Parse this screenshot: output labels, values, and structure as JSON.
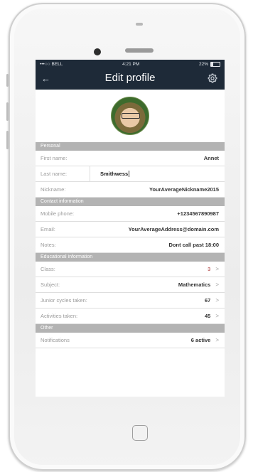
{
  "status_bar": {
    "carrier": "•••○○ BELL",
    "time": "4:21 PM",
    "battery": "22%",
    "battery_level": 0.22
  },
  "nav": {
    "title": "Edit profile",
    "back_icon": "arrow-left-icon",
    "settings_icon": "gear-icon"
  },
  "sections": {
    "personal": "Personal",
    "contact": "Contact information",
    "educational": "Educational information",
    "other": "Other"
  },
  "personal": {
    "first_name": {
      "label": "First name:",
      "value": "Annet"
    },
    "last_name": {
      "label": "Last name:",
      "value": "Smithwess"
    },
    "nickname": {
      "label": "Nickname:",
      "value": "YourAverageNickname2015"
    }
  },
  "contact": {
    "mobile": {
      "label": "Mobile phone:",
      "value": "+1234567890987"
    },
    "email": {
      "label": "Email:",
      "value": "YourAverageAddress@domain.com"
    },
    "notes": {
      "label": "Notes:",
      "value": "Dont call past 18:00"
    }
  },
  "educational": {
    "class": {
      "label": "Class:",
      "value": "3"
    },
    "subject": {
      "label": "Subject:",
      "value": "Mathematics"
    },
    "junior_cycles": {
      "label": "Junior cycles taken:",
      "value": "67"
    },
    "activities": {
      "label": "Activities taken:",
      "value": "45"
    }
  },
  "other": {
    "notifications": {
      "label": "Notifications",
      "value": "6 active"
    }
  },
  "colors": {
    "nav_bg": "#1e2a38",
    "section_bg": "#b3b3b3",
    "accent": "#c06767"
  }
}
